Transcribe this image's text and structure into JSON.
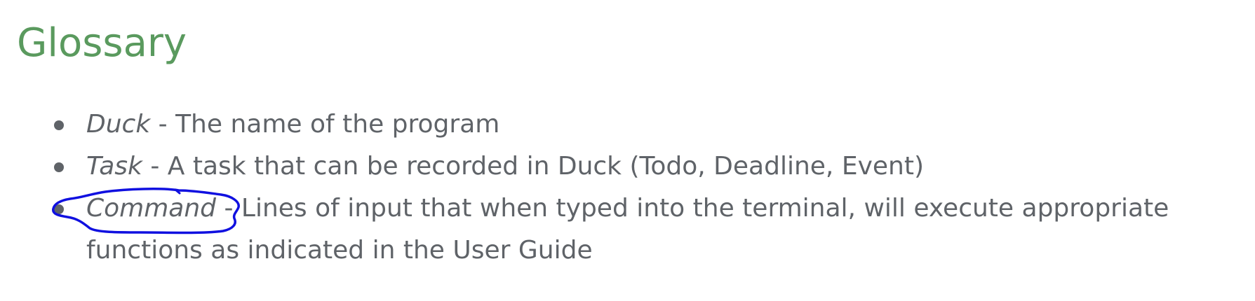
{
  "heading": "Glossary",
  "items": [
    {
      "term": "Duck",
      "definition": " - The name of the program"
    },
    {
      "term": "Task",
      "definition": " - A task that can be recorded in Duck (Todo, Deadline, Event)"
    },
    {
      "term": "Command",
      "definition": " - Lines of input that when typed into the terminal, will execute appropriate functions as indicated in the User Guide"
    }
  ],
  "colors": {
    "heading": "#5a9a5e",
    "body_text": "#5f6368",
    "annotation_ink": "#1010e0"
  }
}
